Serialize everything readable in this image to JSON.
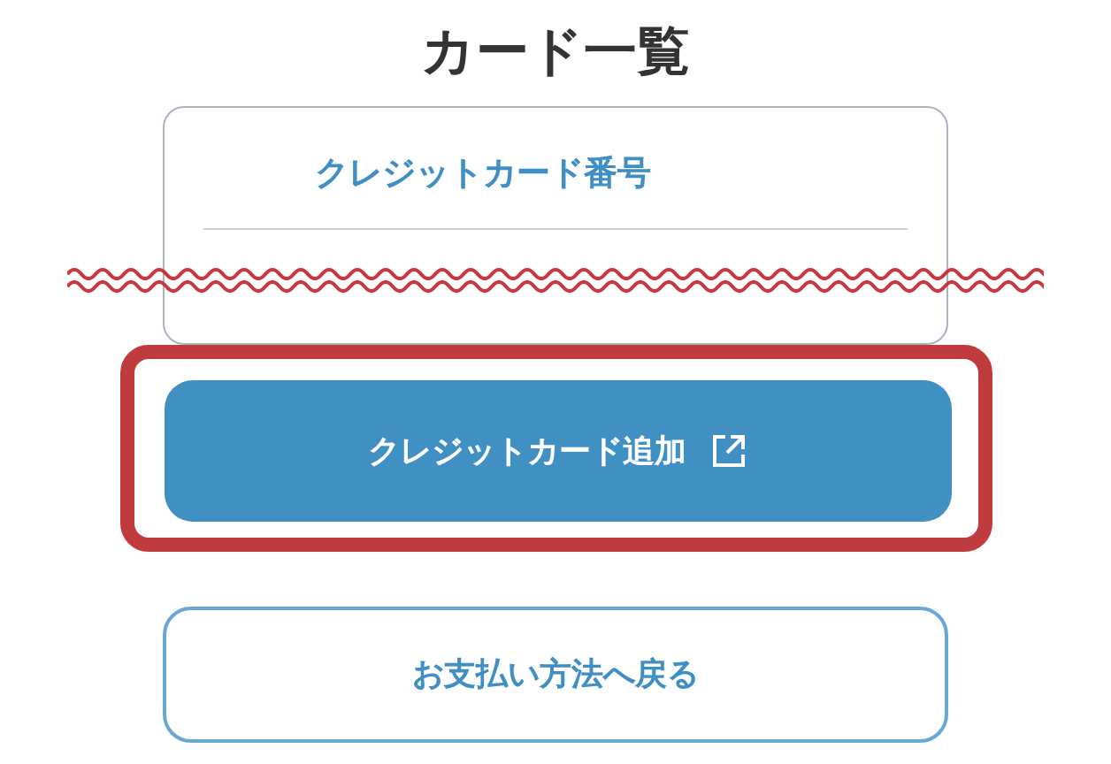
{
  "title": "カード一覧",
  "card": {
    "label": "クレジットカード番号"
  },
  "add_button": {
    "label": "クレジットカード追加"
  },
  "back_button": {
    "label": "お支払い方法へ戻る"
  }
}
